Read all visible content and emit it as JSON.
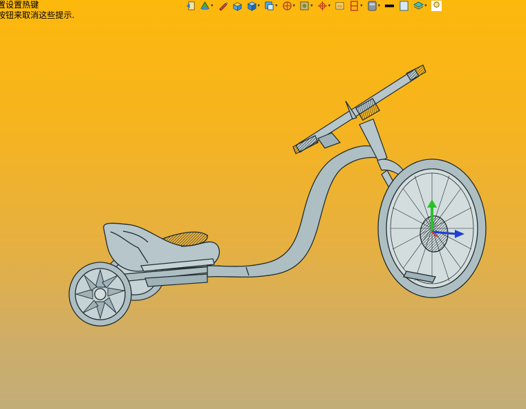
{
  "hint": {
    "line1": "置设置热键",
    "line2": "按钮来取消这些提示."
  },
  "toolbar": {
    "items": [
      {
        "name": "previous-view-icon",
        "dropdown": false
      },
      {
        "name": "section-view-icon",
        "dropdown": true
      },
      {
        "name": "sketch-pencil-icon",
        "dropdown": false
      },
      {
        "name": "dynamic-annotation-icon",
        "dropdown": false
      },
      {
        "name": "display-style-icon",
        "dropdown": true
      },
      {
        "name": "view-orientation-icon",
        "dropdown": true
      },
      {
        "name": "hide-show-items-icon",
        "dropdown": true
      },
      {
        "name": "edit-appearance-icon",
        "dropdown": true
      },
      {
        "name": "apply-scene-icon",
        "dropdown": true
      },
      {
        "name": "view-settings-icon",
        "dropdown": false
      },
      {
        "name": "render-tools-icon",
        "dropdown": true
      },
      {
        "name": "display-pane-icon",
        "dropdown": true
      }
    ],
    "dropdown_glyph": "▾"
  },
  "colors": {
    "background_top": "#fdb80c",
    "background_bottom": "#c2ad78",
    "model_fill": "#aebfc4",
    "model_edge": "#1e2a2e",
    "triad_x": "#1f3fd6",
    "triad_y": "#2bc02b",
    "triad_z": "#d43a2a"
  }
}
